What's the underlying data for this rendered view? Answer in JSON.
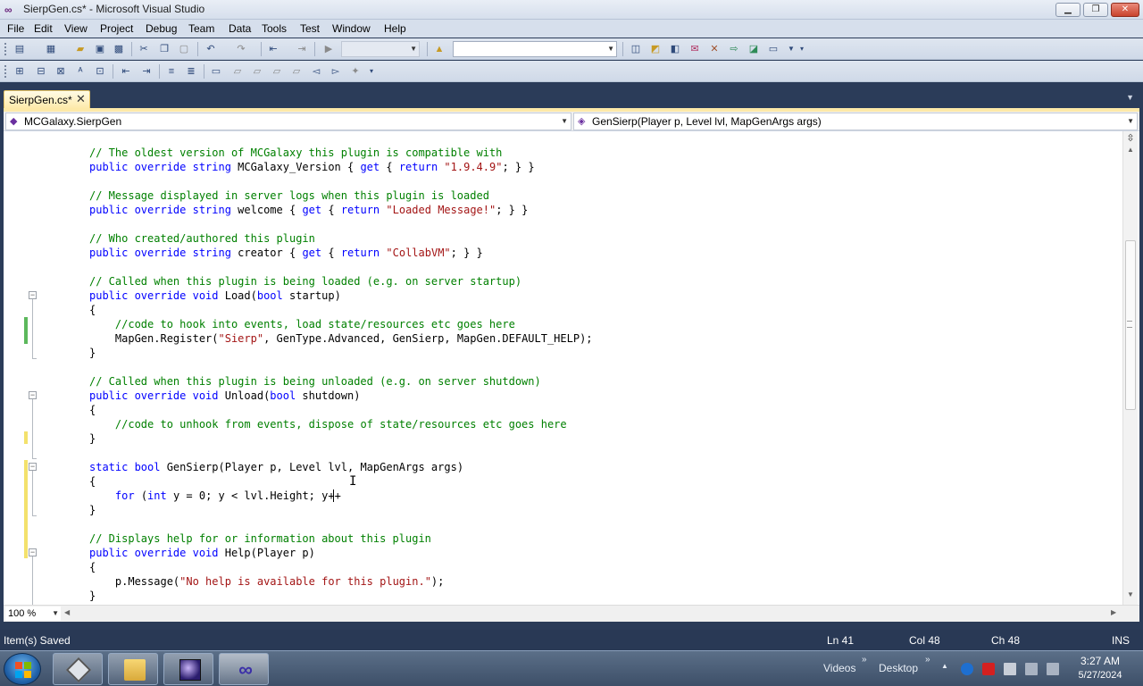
{
  "window": {
    "title": "SierpGen.cs* - Microsoft Visual Studio",
    "min": "▁",
    "max": "❐",
    "close": "✕"
  },
  "menu": [
    "File",
    "Edit",
    "View",
    "Project",
    "Debug",
    "Team",
    "Data",
    "Tools",
    "Test",
    "Window",
    "Help"
  ],
  "tab": {
    "label": "SierpGen.cs*",
    "close": "✕"
  },
  "nav": {
    "left": "MCGalaxy.SierpGen",
    "right": "GenSierp(Player p, Level lvl, MapGenArgs args)"
  },
  "code": [
    [
      {
        "t": "// The oldest version of MCGalaxy this plugin is compatible with",
        "c": "cm"
      }
    ],
    [
      {
        "t": "public override string",
        "c": "kw"
      },
      {
        "t": " MCGalaxy_Version { "
      },
      {
        "t": "get",
        "c": "kw"
      },
      {
        "t": " { "
      },
      {
        "t": "return",
        "c": "kw"
      },
      {
        "t": " "
      },
      {
        "t": "\"1.9.4.9\"",
        "c": "st"
      },
      {
        "t": "; } }"
      }
    ],
    [],
    [
      {
        "t": "// Message displayed in server logs when this plugin is loaded",
        "c": "cm"
      }
    ],
    [
      {
        "t": "public override string",
        "c": "kw"
      },
      {
        "t": " welcome { "
      },
      {
        "t": "get",
        "c": "kw"
      },
      {
        "t": " { "
      },
      {
        "t": "return",
        "c": "kw"
      },
      {
        "t": " "
      },
      {
        "t": "\"Loaded Message!\"",
        "c": "st"
      },
      {
        "t": "; } }"
      }
    ],
    [],
    [
      {
        "t": "// Who created/authored this plugin",
        "c": "cm"
      }
    ],
    [
      {
        "t": "public override string",
        "c": "kw"
      },
      {
        "t": " creator { "
      },
      {
        "t": "get",
        "c": "kw"
      },
      {
        "t": " { "
      },
      {
        "t": "return",
        "c": "kw"
      },
      {
        "t": " "
      },
      {
        "t": "\"CollabVM\"",
        "c": "st"
      },
      {
        "t": "; } }"
      }
    ],
    [],
    [
      {
        "t": "// Called when this plugin is being loaded (e.g. on server startup)",
        "c": "cm"
      }
    ],
    [
      {
        "t": "public override void",
        "c": "kw"
      },
      {
        "t": " Load("
      },
      {
        "t": "bool",
        "c": "kw"
      },
      {
        "t": " startup)"
      }
    ],
    [
      {
        "t": "{"
      }
    ],
    [
      {
        "t": "    "
      },
      {
        "t": "//code to hook into events, load state/resources etc goes here",
        "c": "cm"
      }
    ],
    [
      {
        "t": "    MapGen.Register("
      },
      {
        "t": "\"Sierp\"",
        "c": "st"
      },
      {
        "t": ", GenType.Advanced, GenSierp, MapGen.DEFAULT_HELP);"
      }
    ],
    [
      {
        "t": "}"
      }
    ],
    [],
    [
      {
        "t": "// Called when this plugin is being unloaded (e.g. on server shutdown)",
        "c": "cm"
      }
    ],
    [
      {
        "t": "public override void",
        "c": "kw"
      },
      {
        "t": " Unload("
      },
      {
        "t": "bool",
        "c": "kw"
      },
      {
        "t": " shutdown)"
      }
    ],
    [
      {
        "t": "{"
      }
    ],
    [
      {
        "t": "    "
      },
      {
        "t": "//code to unhook from events, dispose of state/resources etc goes here",
        "c": "cm"
      }
    ],
    [
      {
        "t": "}"
      }
    ],
    [],
    [
      {
        "t": "static bool",
        "c": "kw"
      },
      {
        "t": " GenSierp(Player p, Level lvl, MapGenArgs args)"
      }
    ],
    [
      {
        "t": "{"
      }
    ],
    [
      {
        "t": "    "
      },
      {
        "t": "for",
        "c": "kw"
      },
      {
        "t": " ("
      },
      {
        "t": "int",
        "c": "kw"
      },
      {
        "t": " y = 0; y < lvl.Height; y++"
      }
    ],
    [
      {
        "t": "}"
      }
    ],
    [],
    [
      {
        "t": "// Displays help for or information about this plugin",
        "c": "cm"
      }
    ],
    [
      {
        "t": "public override void",
        "c": "kw"
      },
      {
        "t": " Help(Player p)"
      }
    ],
    [
      {
        "t": "{"
      }
    ],
    [
      {
        "t": "    p.Message("
      },
      {
        "t": "\"No help is available for this plugin.\"",
        "c": "st"
      },
      {
        "t": ");"
      }
    ],
    [
      {
        "t": "}"
      }
    ]
  ],
  "zoom": "100 %",
  "status": {
    "message": "Item(s) Saved",
    "ln": "Ln 41",
    "col": "Col 48",
    "ch": "Ch 48",
    "mode": "INS"
  },
  "taskbar": {
    "videos": "Videos",
    "desktop": "Desktop",
    "time": "3:27 AM",
    "date": "5/27/2024"
  },
  "colors": {
    "keyword": "#0000ff",
    "comment": "#008000",
    "string": "#a31515",
    "status_bg": "#293955",
    "tab_bg": "#fde9a8"
  }
}
